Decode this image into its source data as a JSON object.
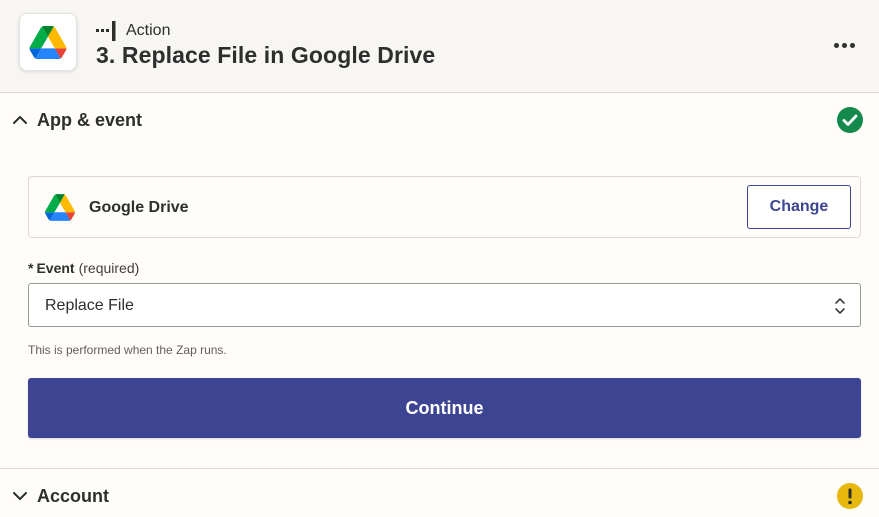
{
  "header": {
    "app_icon": "google-drive-icon",
    "step_kind": "Action",
    "step_kind_icon": "action-step-icon",
    "title": "3. Replace File in Google Drive",
    "more_icon": "more-horizontal-icon"
  },
  "sections": {
    "app_event": {
      "title": "App & event",
      "expanded": true,
      "status": "complete",
      "status_icon": "check-circle-icon",
      "status_color": "#138a4c"
    },
    "account": {
      "title": "Account",
      "expanded": false,
      "status": "warning",
      "status_icon": "warning-circle-icon",
      "status_color": "#e5b80b"
    }
  },
  "app_card": {
    "name": "Google Drive",
    "change_label": "Change"
  },
  "event_field": {
    "required_marker": "*",
    "label": "Event",
    "required_text": "(required)",
    "value": "Replace File",
    "help": "This is performed when the Zap runs."
  },
  "continue_label": "Continue",
  "colors": {
    "primary": "#3d4592",
    "header_bg": "#f7f6f3",
    "page_bg": "#fffdf9",
    "border": "#dcd9d2"
  }
}
